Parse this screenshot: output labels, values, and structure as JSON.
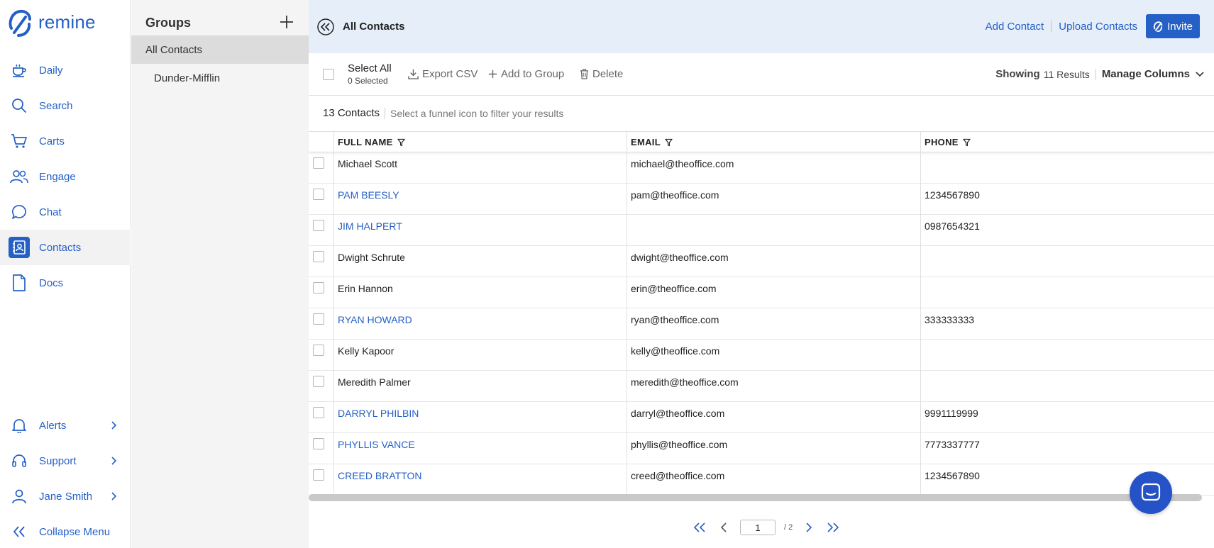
{
  "app": {
    "logo_text": "remine",
    "brand_color": "#2560c6"
  },
  "nav": {
    "items": [
      {
        "label": "Daily",
        "icon": "coffee-cup-icon"
      },
      {
        "label": "Search",
        "icon": "search-icon"
      },
      {
        "label": "Carts",
        "icon": "cart-icon"
      },
      {
        "label": "Engage",
        "icon": "people-icon"
      },
      {
        "label": "Chat",
        "icon": "chat-bubble-icon"
      },
      {
        "label": "Contacts",
        "icon": "contacts-book-icon",
        "active": true
      },
      {
        "label": "Docs",
        "icon": "document-icon"
      }
    ],
    "bottom": [
      {
        "label": "Alerts",
        "icon": "bell-icon"
      },
      {
        "label": "Support",
        "icon": "headset-icon"
      },
      {
        "label": "Jane Smith",
        "icon": "user-icon"
      },
      {
        "label": "Collapse Menu",
        "icon": "double-chevron-left-icon"
      }
    ]
  },
  "groups": {
    "title": "Groups",
    "items": [
      {
        "label": "All Contacts",
        "active": true
      },
      {
        "label": "Dunder-Mifflin"
      }
    ]
  },
  "topbar": {
    "title": "All Contacts",
    "add_contact": "Add Contact",
    "upload_contacts": "Upload Contacts",
    "invite": "Invite"
  },
  "toolbar": {
    "select_all": "Select All",
    "selected_count": "0 Selected",
    "export_csv": "Export CSV",
    "add_to_group": "Add to Group",
    "delete": "Delete",
    "showing_label": "Showing",
    "results": "11 Results",
    "manage_columns": "Manage Columns"
  },
  "countbar": {
    "count": "13 Contacts",
    "hint": "Select a funnel icon to filter your results"
  },
  "table": {
    "columns": [
      "FULL NAME",
      "EMAIL",
      "PHONE"
    ],
    "rows": [
      {
        "name": "Michael Scott",
        "email": "michael@theoffice.com",
        "phone": "",
        "link": false
      },
      {
        "name": "PAM BEESLY",
        "email": "pam@theoffice.com",
        "phone": "1234567890",
        "link": true
      },
      {
        "name": "JIM HALPERT",
        "email": "",
        "phone": "0987654321",
        "link": true
      },
      {
        "name": "Dwight Schrute",
        "email": "dwight@theoffice.com",
        "phone": "",
        "link": false
      },
      {
        "name": "Erin Hannon",
        "email": "erin@theoffice.com",
        "phone": "",
        "link": false
      },
      {
        "name": "RYAN HOWARD",
        "email": "ryan@theoffice.com",
        "phone": "333333333",
        "link": true
      },
      {
        "name": "Kelly Kapoor",
        "email": "kelly@theoffice.com",
        "phone": "",
        "link": false
      },
      {
        "name": "Meredith Palmer",
        "email": "meredith@theoffice.com",
        "phone": "",
        "link": false
      },
      {
        "name": "DARRYL PHILBIN",
        "email": "darryl@theoffice.com",
        "phone": "9991119999",
        "link": true
      },
      {
        "name": "PHYLLIS VANCE",
        "email": "phyllis@theoffice.com",
        "phone": "7773337777",
        "link": true
      },
      {
        "name": "CREED BRATTON",
        "email": "creed@theoffice.com",
        "phone": "1234567890",
        "link": true
      }
    ]
  },
  "pager": {
    "current_page": "1",
    "total": "/ 2"
  }
}
